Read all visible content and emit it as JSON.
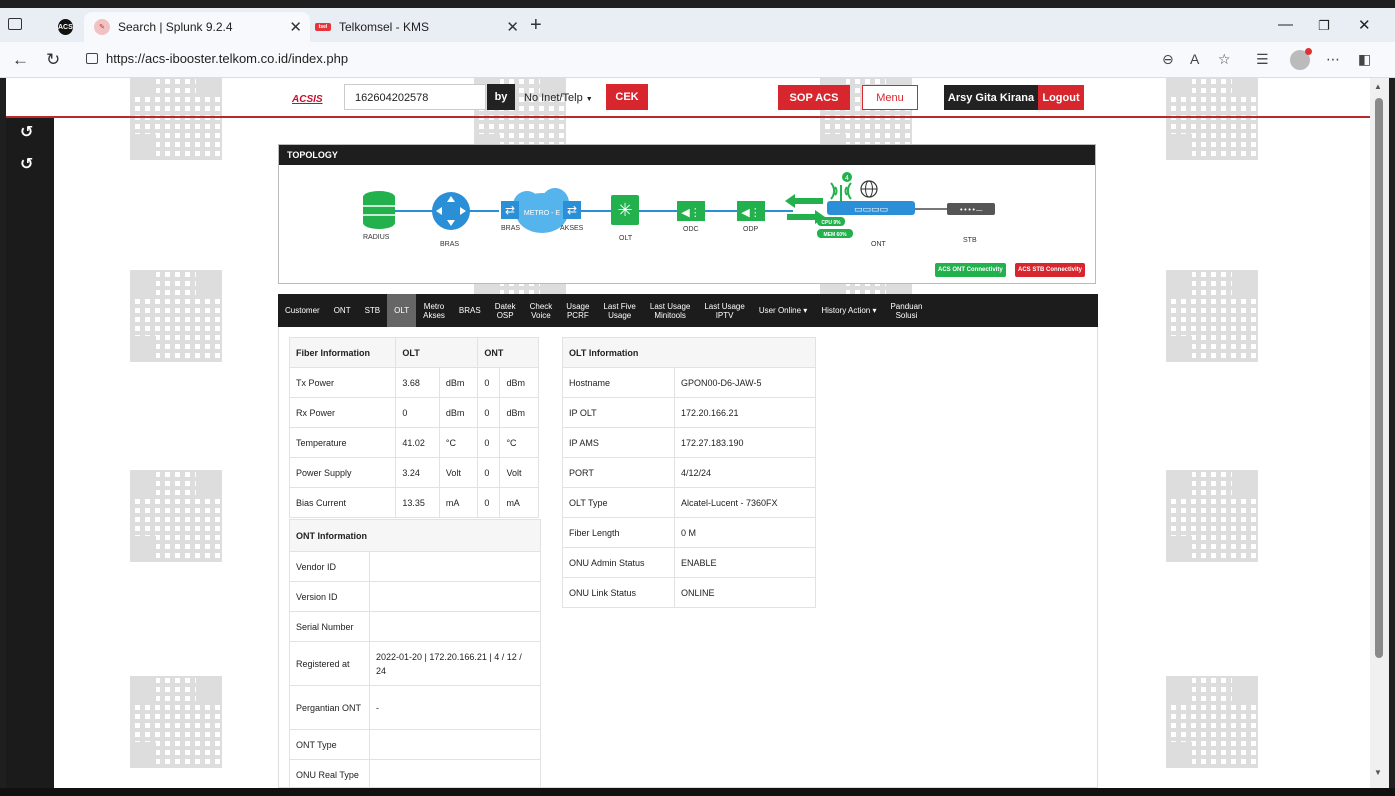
{
  "browser": {
    "tabs": [
      {
        "title": "Search | Splunk 9.2.4",
        "active": true
      },
      {
        "title": "Telkomsel - KMS",
        "active": false
      }
    ],
    "url": "https://acs-ibooster.telkom.co.id/index.php"
  },
  "header": {
    "logo": "ACSIS",
    "search_value": "162604202578",
    "by_label": "by",
    "search_type": "No Inet/Telp",
    "cek_label": "CEK",
    "sop_label": "SOP ACS",
    "menu_label": "Menu",
    "user_name": "Arsy Gita Kirana",
    "logout_label": "Logout"
  },
  "topology": {
    "title": "TOPOLOGY",
    "nodes": [
      "RADIUS",
      "BRAS",
      "BRAS",
      "AKSES",
      "OLT",
      "ODC",
      "ODP",
      "ONT",
      "STB"
    ],
    "cloud_label": "METRO - E",
    "cpu_label": "CPU 9%",
    "mem_label": "MEM 60%",
    "wifi_count": "4",
    "acs_ont": "ACS ONT Connectivity",
    "acs_stb": "ACS STB Connectivity",
    "colors": {
      "blue": "#2a8fd6",
      "green": "#22b14c",
      "red": "#d8262e"
    }
  },
  "tabs": [
    "Customer",
    "ONT",
    "STB",
    "OLT",
    "Metro\nAkses",
    "BRAS",
    "Datek\nOSP",
    "Check\nVoice",
    "Usage\nPCRF",
    "Last Five\nUsage",
    "Last Usage\nMinitools",
    "Last Usage\nIPTV",
    "User Online ▾",
    "History Action ▾",
    "Panduan\nSolusi"
  ],
  "active_tab": "OLT",
  "fiber": {
    "headers": [
      "Fiber Information",
      "OLT",
      "ONT"
    ],
    "rows": [
      {
        "label": "Tx Power",
        "olt": "3.68",
        "olt_unit": "dBm",
        "ont": "0",
        "ont_unit": "dBm"
      },
      {
        "label": "Rx Power",
        "olt": "0",
        "olt_unit": "dBm",
        "ont": "0",
        "ont_unit": "dBm"
      },
      {
        "label": "Temperature",
        "olt": "41.02",
        "olt_unit": "°C",
        "ont": "0",
        "ont_unit": "°C"
      },
      {
        "label": "Power Supply",
        "olt": "3.24",
        "olt_unit": "Volt",
        "ont": "0",
        "ont_unit": "Volt"
      },
      {
        "label": "Bias Current",
        "olt": "13.35",
        "olt_unit": "mA",
        "ont": "0",
        "ont_unit": "mA"
      }
    ]
  },
  "olt_info": {
    "header": "OLT Information",
    "rows": [
      {
        "label": "Hostname",
        "value": "GPON00-D6-JAW-5"
      },
      {
        "label": "IP OLT",
        "value": "172.20.166.21"
      },
      {
        "label": "IP AMS",
        "value": "172.27.183.190"
      },
      {
        "label": "PORT",
        "value": "4/12/24"
      },
      {
        "label": "OLT Type",
        "value": "Alcatel-Lucent - 7360FX"
      },
      {
        "label": "Fiber Length",
        "value": "0 M"
      },
      {
        "label": "ONU Admin Status",
        "value": "ENABLE"
      },
      {
        "label": "ONU Link Status",
        "value": "ONLINE"
      }
    ]
  },
  "ont_info": {
    "header": "ONT Information",
    "rows": [
      {
        "label": "Vendor ID",
        "value": ""
      },
      {
        "label": "Version ID",
        "value": ""
      },
      {
        "label": "Serial Number",
        "value": ""
      },
      {
        "label": "Registered at",
        "value": "2022-01-20 | 172.20.166.21 | 4 / 12 / 24"
      },
      {
        "label": "Pergantian ONT",
        "value": "-"
      },
      {
        "label": "ONT Type",
        "value": ""
      },
      {
        "label": "ONU Real Type",
        "value": ""
      }
    ]
  }
}
